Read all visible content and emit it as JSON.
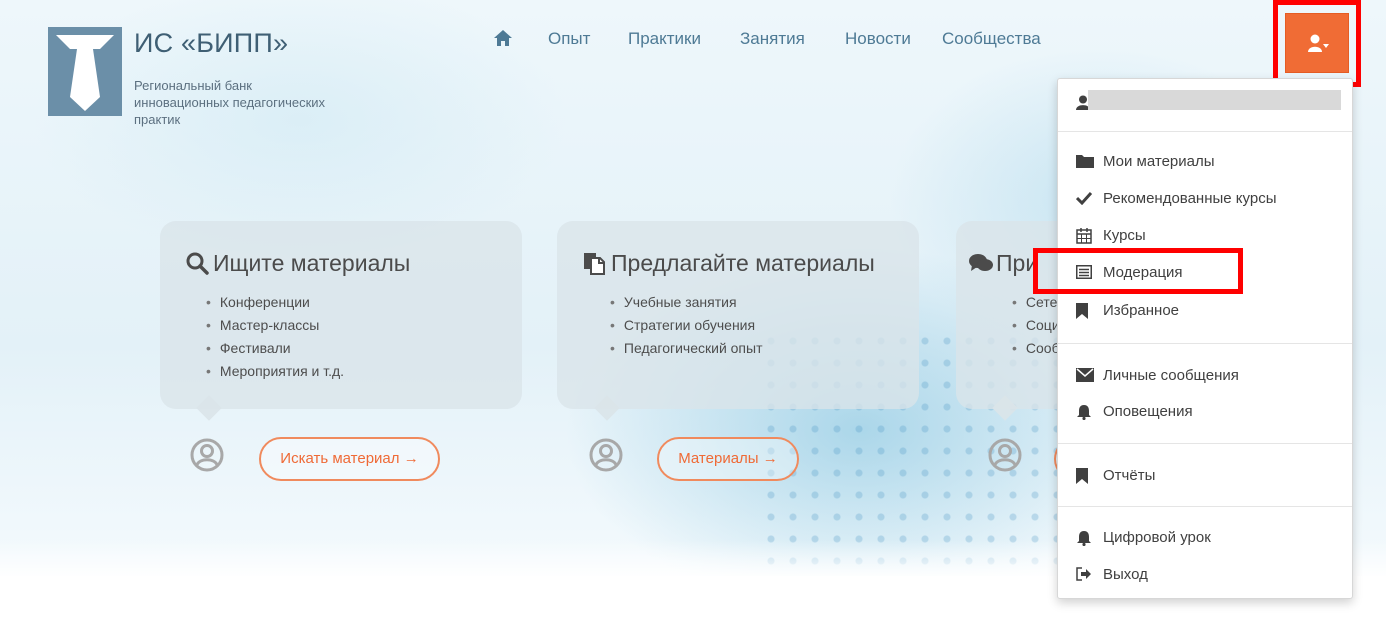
{
  "site": {
    "title": "ИС «БИПП»",
    "subtitle": "Региональный банк инновационных педагогических практик"
  },
  "nav": {
    "home_icon": "home-icon",
    "items": [
      "Опыт",
      "Практики",
      "Занятия",
      "Новости",
      "Сообщества"
    ]
  },
  "profile_button": {
    "icon": "user-icon",
    "accent": "#f06c35"
  },
  "cards": [
    {
      "icon": "search-icon",
      "title": "Ищите материалы",
      "items": [
        "Конференции",
        "Мастер-классы",
        "Фестивали",
        "Мероприятия и т.д."
      ],
      "button": "Искать материал →"
    },
    {
      "icon": "document-copy-icon",
      "title": "Предлагайте материалы",
      "items": [
        "Учебные занятия",
        "Стратегии обучения",
        "Педагогический опыт"
      ],
      "button": "Материалы →"
    },
    {
      "icon": "comments-icon",
      "title": "При",
      "items": [
        "Сете",
        "Соци",
        "Сооб"
      ],
      "button": ""
    }
  ],
  "dropdown": {
    "user_name": "",
    "groups": [
      [
        "Мои материалы",
        "Рекомендованные курсы",
        "Курсы",
        "Модерация",
        "Избранное"
      ],
      [
        "Личные сообщения",
        "Оповещения"
      ],
      [
        "Отчёты"
      ],
      [
        "Цифровой урок",
        "Выход"
      ]
    ]
  },
  "colors": {
    "accent": "#f06c35",
    "highlight": "#ff0000",
    "nav_text": "#4e7a95"
  }
}
